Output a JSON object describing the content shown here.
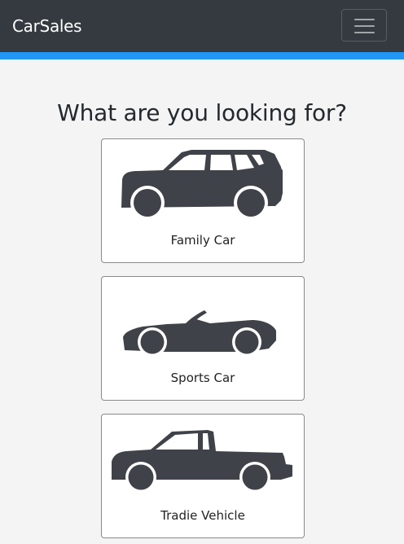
{
  "navbar": {
    "brand": "CarSales",
    "toggler_icon": "hamburger-menu-icon",
    "background": "#343a40",
    "accent_color": "#2196f3"
  },
  "main": {
    "heading": "What are you looking for?",
    "cards": [
      {
        "label": "Family Car",
        "icon": "suv-icon"
      },
      {
        "label": "Sports Car",
        "icon": "convertible-icon"
      },
      {
        "label": "Tradie Vehicle",
        "icon": "pickup-truck-icon"
      }
    ]
  },
  "colors": {
    "page_background": "#f4f4f4",
    "icon_fill": "#3f4249",
    "card_border": "#8a8a8a"
  }
}
